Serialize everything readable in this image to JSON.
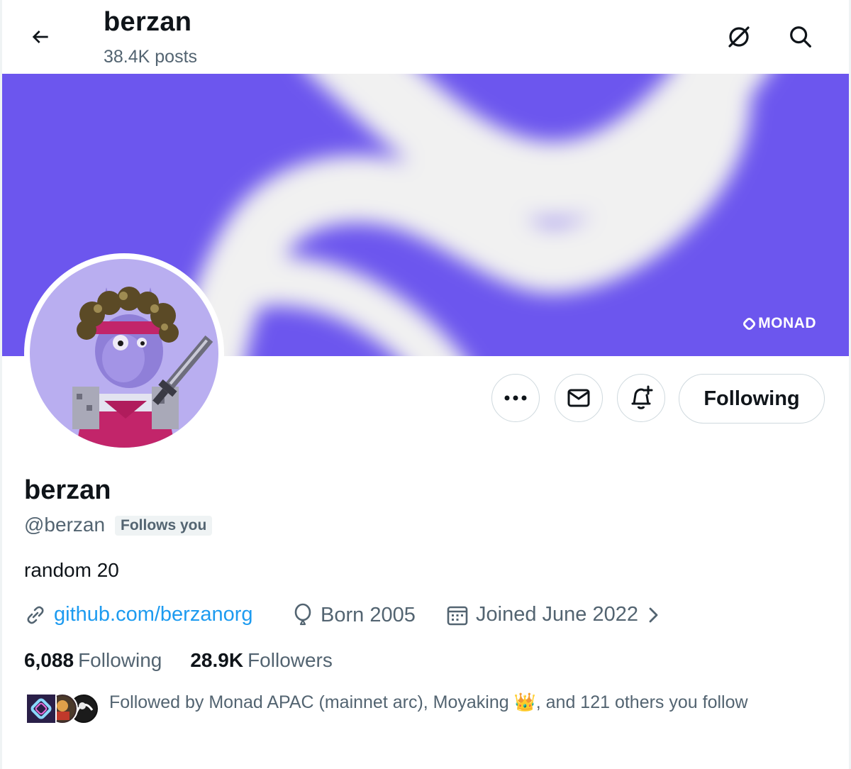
{
  "header": {
    "title": "berzan",
    "post_count": "38.4K posts"
  },
  "banner": {
    "brand": "MONAD",
    "color": "#6c56ee"
  },
  "actions": {
    "more_label": "•••",
    "following_label": "Following"
  },
  "profile": {
    "name": "berzan",
    "handle": "@berzan",
    "follows_you": "Follows you",
    "bio": "random 20",
    "website": "github.com/berzanorg",
    "born": "Born 2005",
    "joined": "Joined June 2022",
    "following_count": "6,088",
    "following_label": "Following",
    "followers_count": "28.9K",
    "followers_label": "Followers",
    "followed_by": "Followed by Monad APAC (mainnet arc), Moyaking 👑, and 121 others you follow"
  },
  "colors": {
    "link": "#1d9bf0",
    "muted": "#536471",
    "text": "#0f1419"
  }
}
